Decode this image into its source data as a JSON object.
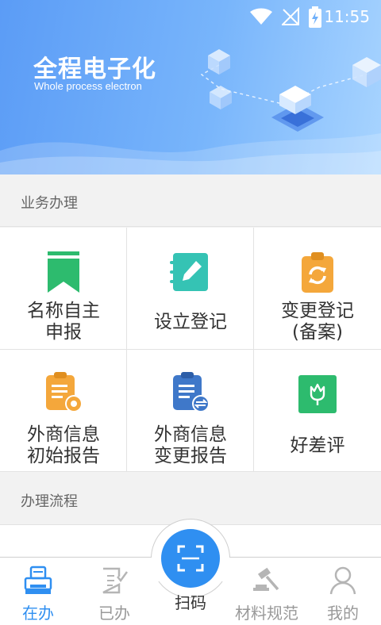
{
  "status_bar": {
    "time": "11:55"
  },
  "hero": {
    "title": "全程电子化",
    "subtitle": "Whole process electron"
  },
  "sections": {
    "business": "业务办理",
    "process": "办理流程"
  },
  "services": [
    {
      "label": "名称自主\n申报",
      "icon": "bookmark-icon",
      "color": "#2dbb6e"
    },
    {
      "label": "设立登记",
      "icon": "notebook-pen-icon",
      "color": "#35c3b4"
    },
    {
      "label": "变更登记\n(备案)",
      "icon": "clipboard-refresh-icon",
      "color": "#f4a73b"
    },
    {
      "label": "外商信息\n初始报告",
      "icon": "clipboard-stamp-icon",
      "color": "#f4a73b"
    },
    {
      "label": "外商信息\n变更报告",
      "icon": "clipboard-exchange-icon",
      "color": "#3f78c9"
    },
    {
      "label": "好差评",
      "icon": "flower-icon",
      "color": "#2dbb6e"
    }
  ],
  "tabs": [
    {
      "label": "在办",
      "icon": "printer-icon",
      "active": true
    },
    {
      "label": "已办",
      "icon": "document-check-icon",
      "active": false
    },
    {
      "label": "扫码",
      "icon": "scan-icon",
      "active": false
    },
    {
      "label": "材料规范",
      "icon": "gavel-icon",
      "active": false
    },
    {
      "label": "我的",
      "icon": "user-icon",
      "active": false
    }
  ],
  "colors": {
    "accent": "#2f8ff1",
    "hero_start": "#5b9cf6",
    "hero_end": "#a8d4ff"
  }
}
